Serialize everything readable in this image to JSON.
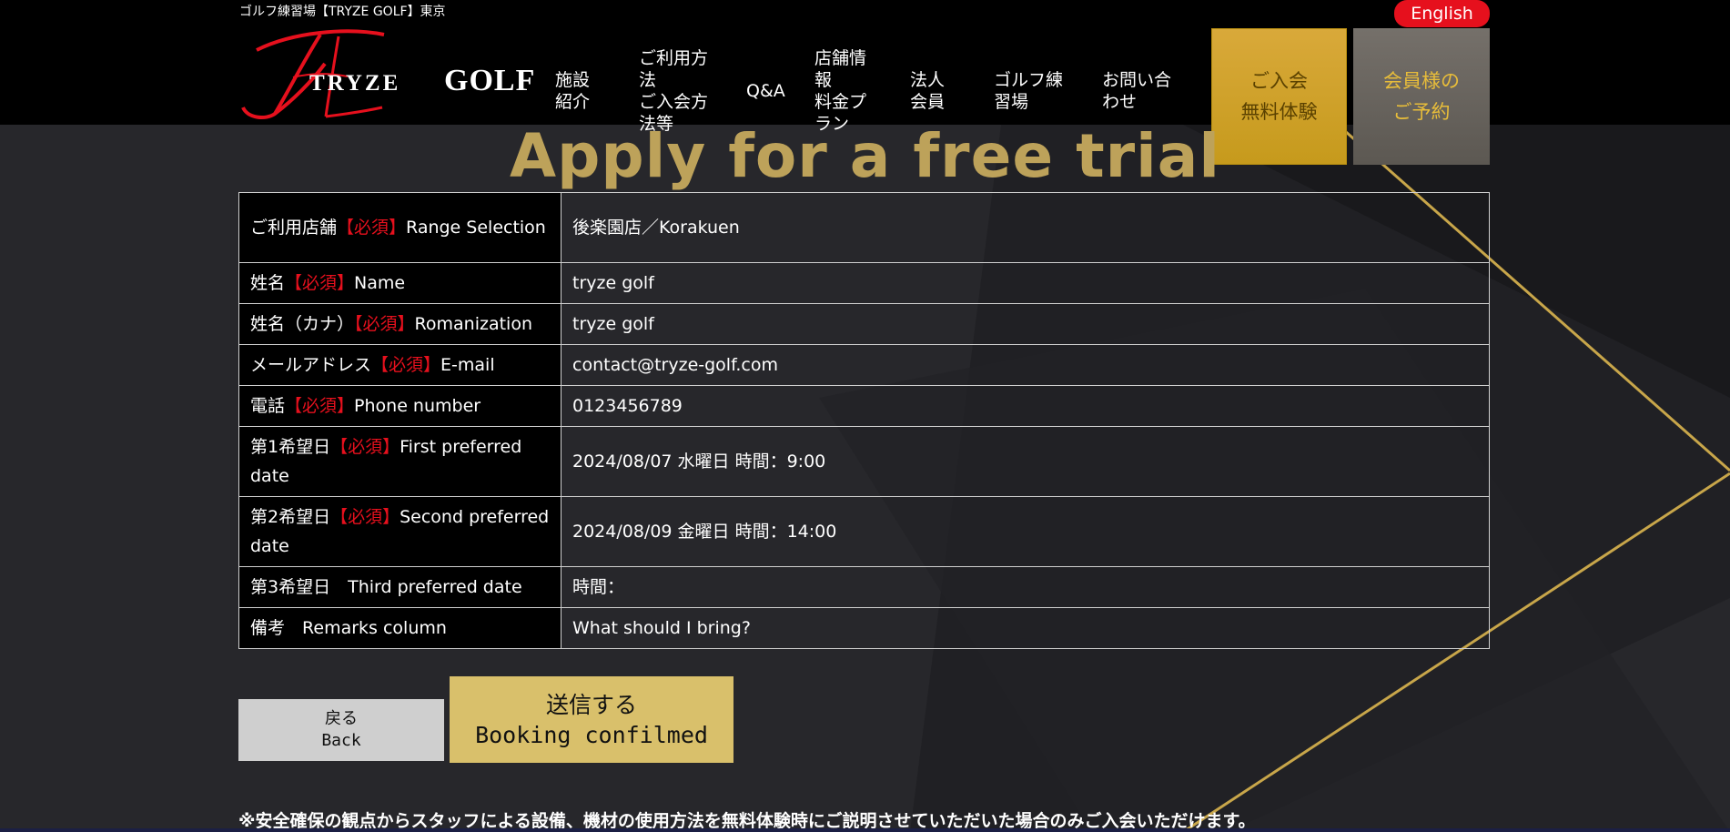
{
  "header": {
    "tagline": "ゴルフ練習場【TRYZE GOLF】東京",
    "language_button": "English",
    "logo": {
      "script_mark": "TrZ",
      "name_part1": "TRYZE",
      "name_part2": "GOLF"
    },
    "nav": [
      {
        "lines": [
          "施設",
          "紹介"
        ]
      },
      {
        "lines": [
          "ご利用方",
          "法",
          "ご入会方",
          "法等"
        ]
      },
      {
        "lines": [
          "Q&A"
        ]
      },
      {
        "lines": [
          "店舗情",
          "報",
          "料金プ",
          "ラン"
        ]
      },
      {
        "lines": [
          "法人",
          "会員"
        ]
      },
      {
        "lines": [
          "ゴルフ練",
          "習場"
        ]
      },
      {
        "lines": [
          "お問い合",
          "わせ"
        ]
      }
    ],
    "cta_trial": [
      "ご入会",
      "無料体験"
    ],
    "cta_member": [
      "会員様の",
      "ご予約"
    ]
  },
  "page": {
    "title": "Apply for a free trial"
  },
  "form": {
    "required_mark": "【必須】",
    "rows": [
      {
        "label_jp": "ご利用店舗",
        "required": true,
        "label_en": "Range Selection",
        "value": "後楽園店／Korakuen"
      },
      {
        "label_jp": "姓名",
        "required": true,
        "label_en": "Name",
        "value": "tryze golf"
      },
      {
        "label_jp": "姓名（カナ）",
        "required": true,
        "label_en": "Romanization",
        "value": "tryze golf"
      },
      {
        "label_jp": "メールアドレス",
        "required": true,
        "label_en": "E-mail",
        "value": "contact@tryze-golf.com"
      },
      {
        "label_jp": "電話",
        "required": true,
        "label_en": "Phone number",
        "value": "0123456789"
      },
      {
        "label_jp": "第1希望日",
        "required": true,
        "label_en": "First preferred date",
        "value": "2024/08/07 水曜日 時間：9:00"
      },
      {
        "label_jp": "第2希望日",
        "required": true,
        "label_en": "Second preferred date",
        "value": "2024/08/09 金曜日 時間：14:00"
      },
      {
        "label_jp": "第3希望日",
        "required": false,
        "label_en": "Third preferred date",
        "value": "時間："
      },
      {
        "label_jp": "備考",
        "required": false,
        "label_en": "Remarks column",
        "value": "What should I bring?"
      }
    ]
  },
  "buttons": {
    "back": [
      "戻る",
      "Back"
    ],
    "submit": [
      "送信する",
      "Booking confilmed"
    ]
  },
  "notice": "※安全確保の観点からスタッフによる設備、機材の使用方法を無料体験時にご説明させていただいた場合のみご入会いただけます。",
  "colors": {
    "required": "#e6101d",
    "title_gold": "#bda25a",
    "cta_gold": "#c69a1c"
  }
}
